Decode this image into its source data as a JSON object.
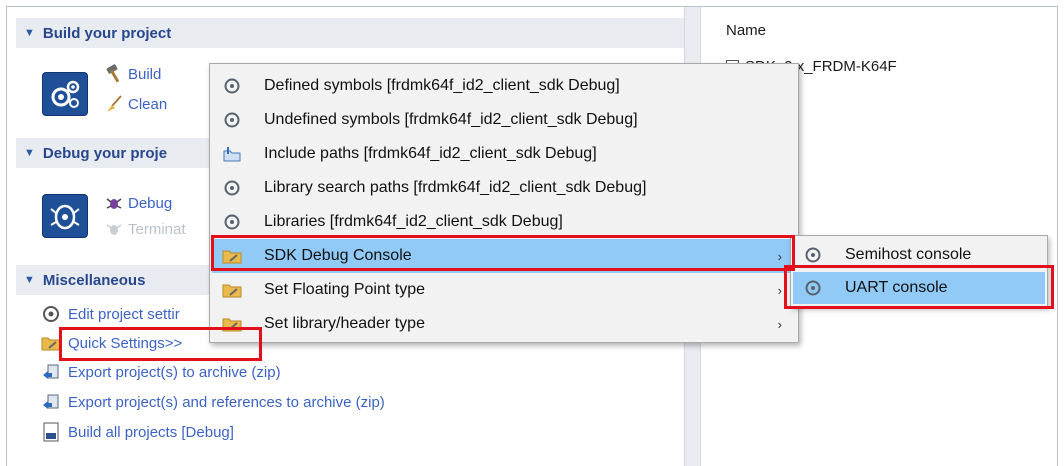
{
  "sections": {
    "build": {
      "title": "Build your project",
      "build_label": "Build",
      "clean_label": "Clean"
    },
    "debug": {
      "title": "Debug your proje",
      "debug_label": "Debug",
      "terminate_label": "Terminat"
    },
    "misc": {
      "title": "Miscellaneous",
      "items": [
        {
          "label": "Edit project settir",
          "icon": "project-settings-icon"
        },
        {
          "label": "Quick Settings>>",
          "icon": "folder-wrench-icon"
        },
        {
          "label": "Export project(s) to archive (zip)",
          "icon": "export-icon"
        },
        {
          "label": "Export project(s) and references to archive (zip)",
          "icon": "export-icon"
        },
        {
          "label": "Build all projects [Debug]",
          "icon": "binary-file-icon"
        }
      ]
    }
  },
  "right_panel": {
    "column_header": "Name",
    "tree_item": "SDK_2.x_FRDM-K64F"
  },
  "context_menu": {
    "items": [
      {
        "label": "Defined symbols [frdmk64f_id2_client_sdk Debug]",
        "icon": "settings-gear-icon",
        "has_submenu": false
      },
      {
        "label": "Undefined symbols [frdmk64f_id2_client_sdk Debug]",
        "icon": "settings-gear-icon",
        "has_submenu": false
      },
      {
        "label": "Include paths [frdmk64f_id2_client_sdk Debug]",
        "icon": "include-path-icon",
        "has_submenu": false
      },
      {
        "label": "Library search paths [frdmk64f_id2_client_sdk Debug]",
        "icon": "settings-gear-icon",
        "has_submenu": false
      },
      {
        "label": "Libraries [frdmk64f_id2_client_sdk Debug]",
        "icon": "settings-gear-icon",
        "has_submenu": false
      },
      {
        "label": "SDK Debug Console",
        "icon": "folder-wrench-icon",
        "has_submenu": true
      },
      {
        "label": "Set Floating Point type",
        "icon": "folder-wrench-icon",
        "has_submenu": true
      },
      {
        "label": "Set library/header type",
        "icon": "folder-wrench-icon",
        "has_submenu": true
      }
    ],
    "submenu_arrow": "›"
  },
  "submenu": {
    "items": [
      {
        "label": "Semihost console",
        "icon": "settings-gear-icon"
      },
      {
        "label": "UART console",
        "icon": "settings-gear-icon"
      }
    ]
  },
  "colors": {
    "highlight": "#91c9f7",
    "red_annotation": "#e3101c",
    "link": "#3b63c6",
    "section_title": "#27468c"
  }
}
